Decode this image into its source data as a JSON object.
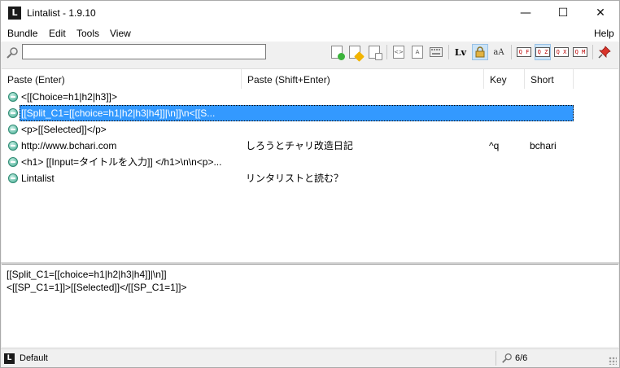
{
  "window": {
    "title": "Lintalist - 1.9.10",
    "app_icon_letter": "L",
    "minimize_glyph": "—",
    "maximize_glyph": "☐",
    "close_glyph": "✕"
  },
  "menu": {
    "bundle": "Bundle",
    "edit": "Edit",
    "tools": "Tools",
    "view": "View",
    "help": "Help"
  },
  "search": {
    "value": "",
    "placeholder": "",
    "icon": "search-icon"
  },
  "toolbar": {
    "lv_label": "Lv",
    "aa_label": "aA",
    "mode_labels": [
      "Q F",
      "Q Z",
      "Q X",
      "Q M"
    ],
    "active_mode": "Q Z",
    "icons": [
      "add-snippet-icon",
      "edit-snippet-icon",
      "copy-snippet-icon",
      "code-snippet-icon",
      "text-snippet-icon",
      "keyboard-icon",
      "lock-icon",
      "pin-icon"
    ]
  },
  "list": {
    "headers": {
      "paste": "Paste (Enter)",
      "paste_shift": "Paste (Shift+Enter)",
      "key": "Key",
      "short": "Short"
    },
    "rows": [
      {
        "paste": "<[[Choice=h1|h2|h3]]>",
        "paste_shift": "",
        "key": "",
        "short": ""
      },
      {
        "paste": "[[Split_C1=[[choice=h1|h2|h3|h4]]|\\n]]\\n<[[S...",
        "paste_shift": "",
        "key": "",
        "short": ""
      },
      {
        "paste": "<p>[[Selected]]</p>",
        "paste_shift": "",
        "key": "",
        "short": ""
      },
      {
        "paste": "http://www.bchari.com",
        "paste_shift": "しろうとチャリ改造日記",
        "key": "^q",
        "short": "bchari"
      },
      {
        "paste": "<h1> [[Input=タイトルを入力]] </h1>\\n\\n<p>...",
        "paste_shift": "",
        "key": "",
        "short": ""
      },
      {
        "paste": "Lintalist",
        "paste_shift": "リンタリストと読む？",
        "key": "",
        "short": ""
      }
    ],
    "selected_index": 1
  },
  "preview": {
    "line1": "[[Split_C1=[[choice=h1|h2|h3|h4]]|\\n]]",
    "line2": "<[[SP_C1=1]]>[[Selected]]</[[SP_C1=1]]>"
  },
  "status": {
    "bundle": "Default",
    "count": "6/6",
    "icon_letter": "L"
  },
  "colors": {
    "selection": "#3399ff",
    "row_icon": "#3fa98f"
  }
}
